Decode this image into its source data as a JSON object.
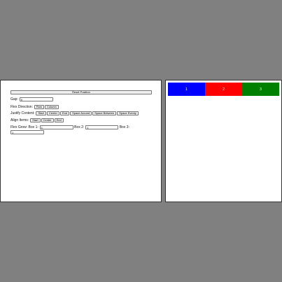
{
  "controls": {
    "reset_label": "Reset Position",
    "gap": {
      "label": "Gap:",
      "value": "0"
    },
    "direction": {
      "label": "Flex Direction:",
      "options": [
        "Row",
        "Column"
      ]
    },
    "justify": {
      "label": "Justify Content:",
      "options": [
        "Start",
        "Center",
        "End",
        "Space Around",
        "Space Between",
        "Space Evenly"
      ]
    },
    "align": {
      "label": "Align Items:",
      "options": [
        "Start",
        "Center",
        "End"
      ]
    },
    "grow": {
      "label": "Flex Grow: Box 1:",
      "box1_value": "1",
      "box2_label": "Box 2:",
      "box2_value": "1",
      "box3_label": "Box 3:",
      "box3_value": "1"
    }
  },
  "preview": {
    "boxes": [
      {
        "label": "1",
        "color": "#0000ff"
      },
      {
        "label": "2",
        "color": "#ff0000"
      },
      {
        "label": "3",
        "color": "#008000"
      }
    ]
  }
}
